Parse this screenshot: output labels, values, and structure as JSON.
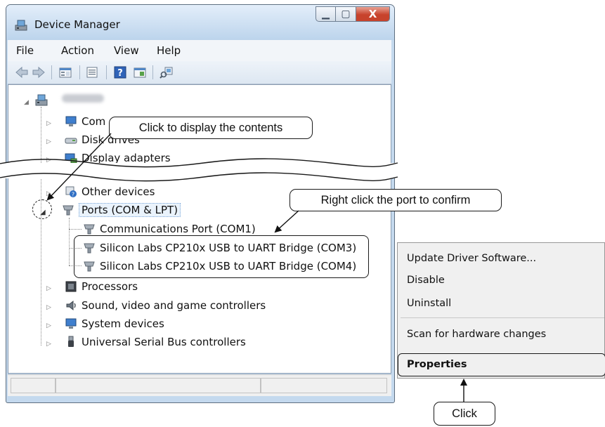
{
  "window": {
    "title": "Device Manager",
    "minimize": "▁",
    "maximize": "▢",
    "close": "X"
  },
  "menu": {
    "file": "File",
    "action": "Action",
    "view": "View",
    "help": "Help"
  },
  "toolbar": {
    "buttons": [
      "back-icon",
      "forward-icon",
      "properties-icon",
      "properties-sheet-icon",
      "help-icon",
      "update-driver-icon",
      "scan-hardware-icon"
    ]
  },
  "tree": {
    "computer_name_blurred": true,
    "items": [
      {
        "label": "Com",
        "icon": "computer-icon"
      },
      {
        "label": "Disk drives",
        "icon": "disk-icon"
      },
      {
        "label": "Display adapters",
        "icon": "display-icon"
      },
      {
        "label": "Other devices",
        "icon": "other-devices-icon"
      },
      {
        "label": "Ports (COM & LPT)",
        "icon": "port-icon"
      },
      {
        "label": "Communications Port (COM1)",
        "icon": "port-icon"
      },
      {
        "label": "Silicon Labs CP210x USB to UART Bridge (COM3)",
        "icon": "port-icon"
      },
      {
        "label": "Silicon Labs CP210x USB to UART Bridge (COM4)",
        "icon": "port-icon"
      },
      {
        "label": "Processors",
        "icon": "processor-icon"
      },
      {
        "label": "Sound, video and game controllers",
        "icon": "sound-icon"
      },
      {
        "label": "System devices",
        "icon": "system-icon"
      },
      {
        "label": "Universal Serial Bus controllers",
        "icon": "usb-icon"
      }
    ]
  },
  "context_menu": {
    "items": [
      "Update Driver Software...",
      "Disable",
      "Uninstall",
      "Scan for hardware changes",
      "Properties"
    ]
  },
  "callouts": {
    "expand": "Click to display the contents",
    "port": "Right click the port to confirm",
    "click": "Click"
  }
}
